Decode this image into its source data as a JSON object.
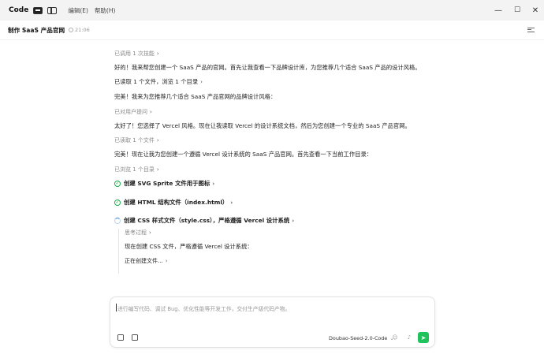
{
  "titlebar": {
    "app_name": "Code",
    "menus": [
      "编辑(E)",
      "帮助(H)"
    ],
    "icons": [
      "terminal-icon",
      "sidebar-icon"
    ],
    "controls": {
      "minimize": "—",
      "maximize": "☐",
      "close": "✕"
    }
  },
  "header": {
    "title": "制作 SaaS 产品官网",
    "time": "21:06"
  },
  "messages": {
    "skill_used": "已调用 1 次技能",
    "m1": "好的！我来帮您创建一个 SaaS 产品的官网。首先让我查看一下品牌设计库，为您推荐几个适合 SaaS 产品的设计风格。",
    "read_browse": "已读取 1 个文件，浏览 1 个目录",
    "m2": "完美！我来为您推荐几个适合 SaaS 产品官网的品牌设计风格：",
    "asked_user": "已对用户提问",
    "m3": "太好了！您选择了 Vercel 风格。现在让我读取 Vercel 的设计系统文档，然后为您创建一个专业的 SaaS 产品官网。",
    "read_file": "已读取 1 个文件",
    "m4": "完美！现在让我为您创建一个遵循 Vercel 设计系统的 SaaS 产品官网。首先查看一下当前工作目录：",
    "browsed_dir": "已浏览 1 个目录",
    "task1": "创建 SVG Sprite 文件用于图标",
    "task2": "创建 HTML 结构文件（index.html）",
    "task3": "创建 CSS 样式文件（style.css），严格遵循 Vercel 设计系统",
    "thinking_label": "思考过程",
    "thinking_text": "现在创建 CSS 文件，严格遵循 Vercel 设计系统：",
    "creating": "正在创建文件..."
  },
  "input": {
    "placeholder": "进行编写代码、调试 Bug、优化性能等开发工作，交付生产级代码产物。",
    "model": "Doubao-Seed-2.0-Code"
  },
  "colors": {
    "accent_green": "#21c25c",
    "check_green": "#20b04b",
    "spinner_blue": "#3a86d8"
  }
}
